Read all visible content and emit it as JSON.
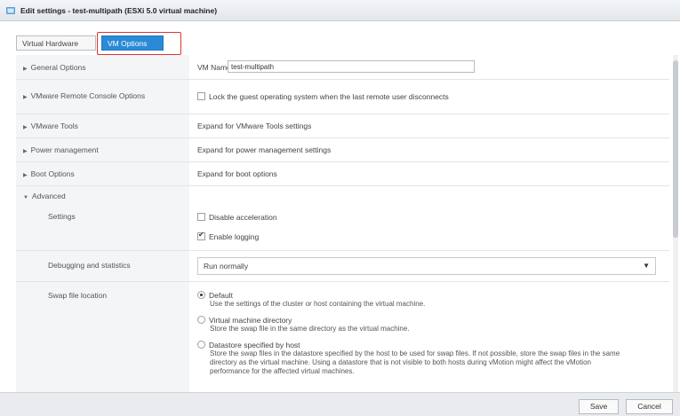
{
  "window": {
    "title": "Edit settings - test-multipath (ESXi 5.0 virtual machine)",
    "icon": "vm-icon"
  },
  "tabs": [
    {
      "label": "Virtual Hardware",
      "active": false
    },
    {
      "label": "VM Options",
      "active": true
    }
  ],
  "general": {
    "label": "General Options",
    "vm_name_label": "VM Name:",
    "vm_name_value": "test-multipath"
  },
  "vmrc": {
    "label": "VMware Remote Console Options",
    "lock_label": "Lock the guest operating system when the last remote user disconnects",
    "lock_checked": false
  },
  "tools": {
    "label": "VMware Tools",
    "desc": "Expand for VMware Tools settings"
  },
  "power": {
    "label": "Power management",
    "desc": "Expand for power management settings"
  },
  "boot": {
    "label": "Boot Options",
    "desc": "Expand for boot options"
  },
  "advanced": {
    "label": "Advanced",
    "settings_label": "Settings",
    "disable_accel_label": "Disable acceleration",
    "disable_accel_checked": false,
    "enable_logging_label": "Enable logging",
    "enable_logging_checked": true,
    "debug_label": "Debugging and statistics",
    "debug_value": "Run normally",
    "swap_label": "Swap file location",
    "swap_options": [
      {
        "label": "Default",
        "desc": "Use the settings of the cluster or host containing the virtual machine.",
        "selected": true
      },
      {
        "label": "Virtual machine directory",
        "desc": "Store the swap file in the same directory as the virtual machine.",
        "selected": false
      },
      {
        "label": "Datastore specified by host",
        "desc": "Store the swap files in the datastore specified by the host to be used for swap files. If not possible, store the swap files in the same directory as the virtual machine. Using a datastore that is not visible to both hosts during vMotion might affect the vMotion performance for the affected virtual machines.",
        "selected": false
      }
    ]
  },
  "footer": {
    "save_label": "Save",
    "cancel_label": "Cancel"
  },
  "colors": {
    "accent": "#2b8ad6",
    "highlight": "#dd3333"
  }
}
